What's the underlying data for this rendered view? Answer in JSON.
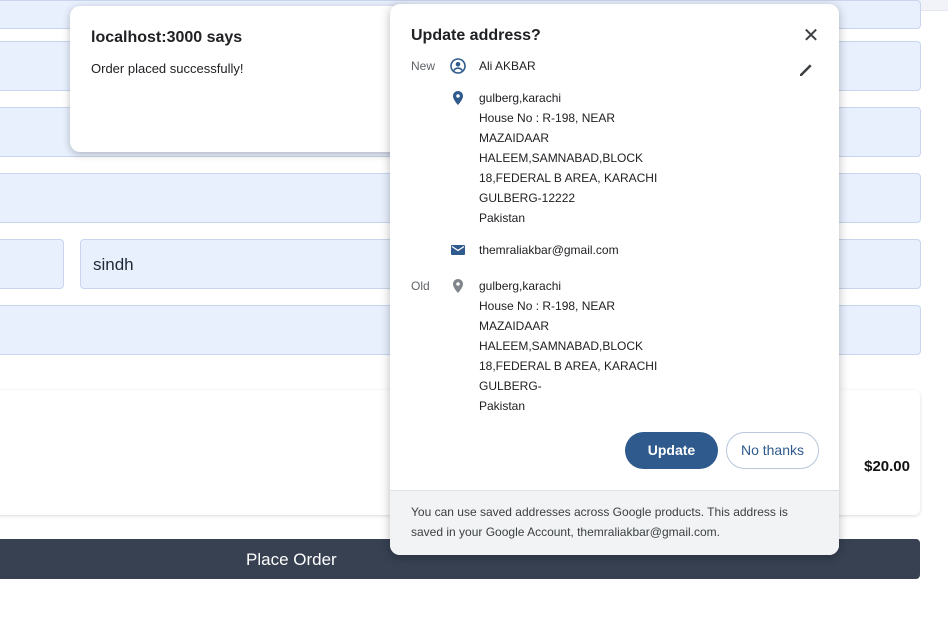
{
  "form": {
    "state_value": "sindh"
  },
  "summary": {
    "total": "$20.00"
  },
  "place_order_label": "Place Order",
  "alert": {
    "title": "localhost:3000 says",
    "message": "Order placed successfully!"
  },
  "popup": {
    "title": "Update address?",
    "new_label": "New",
    "old_label": "Old",
    "name": "Ali AKBAR",
    "new_address_lines": [
      "gulberg,karachi",
      "House No : R-198, NEAR",
      "MAZAIDAAR",
      "HALEEM,SAMNABAD,BLOCK",
      "18,FEDERAL B AREA, KARACHI",
      "GULBERG-12222",
      "Pakistan"
    ],
    "email": "themraliakbar@gmail.com",
    "old_address_lines": [
      "gulberg,karachi",
      "House No : R-198, NEAR",
      "MAZAIDAAR",
      "HALEEM,SAMNABAD,BLOCK",
      "18,FEDERAL B AREA, KARACHI",
      "GULBERG-",
      "Pakistan"
    ],
    "update_label": "Update",
    "no_thanks_label": "No thanks",
    "footer": "You can use saved addresses across Google products. This address is saved in your Google Account, themraliakbar@gmail.com.",
    "icons": {
      "close": "close-icon",
      "edit": "pencil-icon",
      "person": "account-circle-icon",
      "location": "location-pin-icon",
      "email": "mail-icon"
    },
    "accent_color": "#2f5a8d"
  }
}
